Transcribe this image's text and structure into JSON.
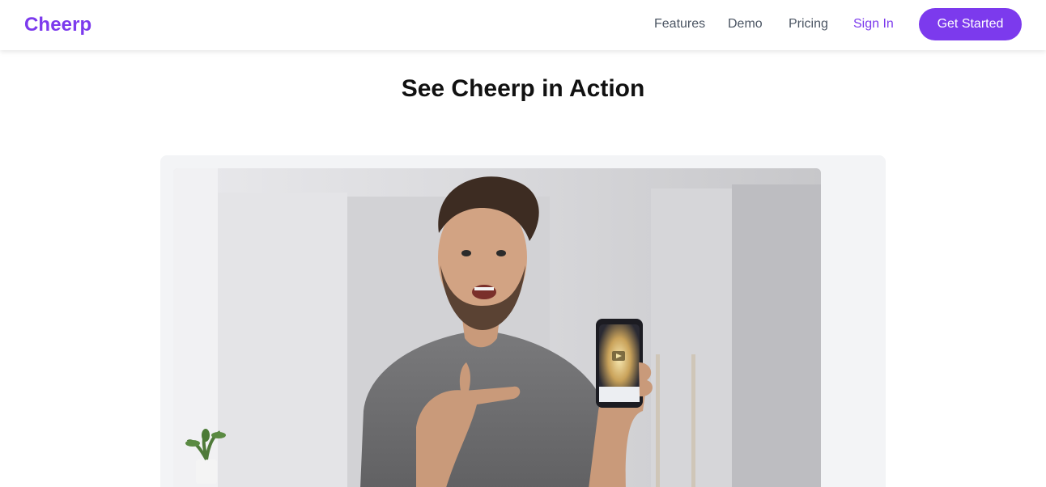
{
  "brand": {
    "name": "Cheerp",
    "accent_color": "#7c3aed"
  },
  "nav": {
    "links": [
      "Features",
      "Demo",
      "Pricing"
    ],
    "sign_in": "Sign In",
    "cta": "Get Started"
  },
  "demo": {
    "title": "See Cheerp in Action",
    "video": {
      "thumbnail_description": "man smiling and pointing at a smartphone showing a play button",
      "play_icon": "play-icon"
    }
  }
}
